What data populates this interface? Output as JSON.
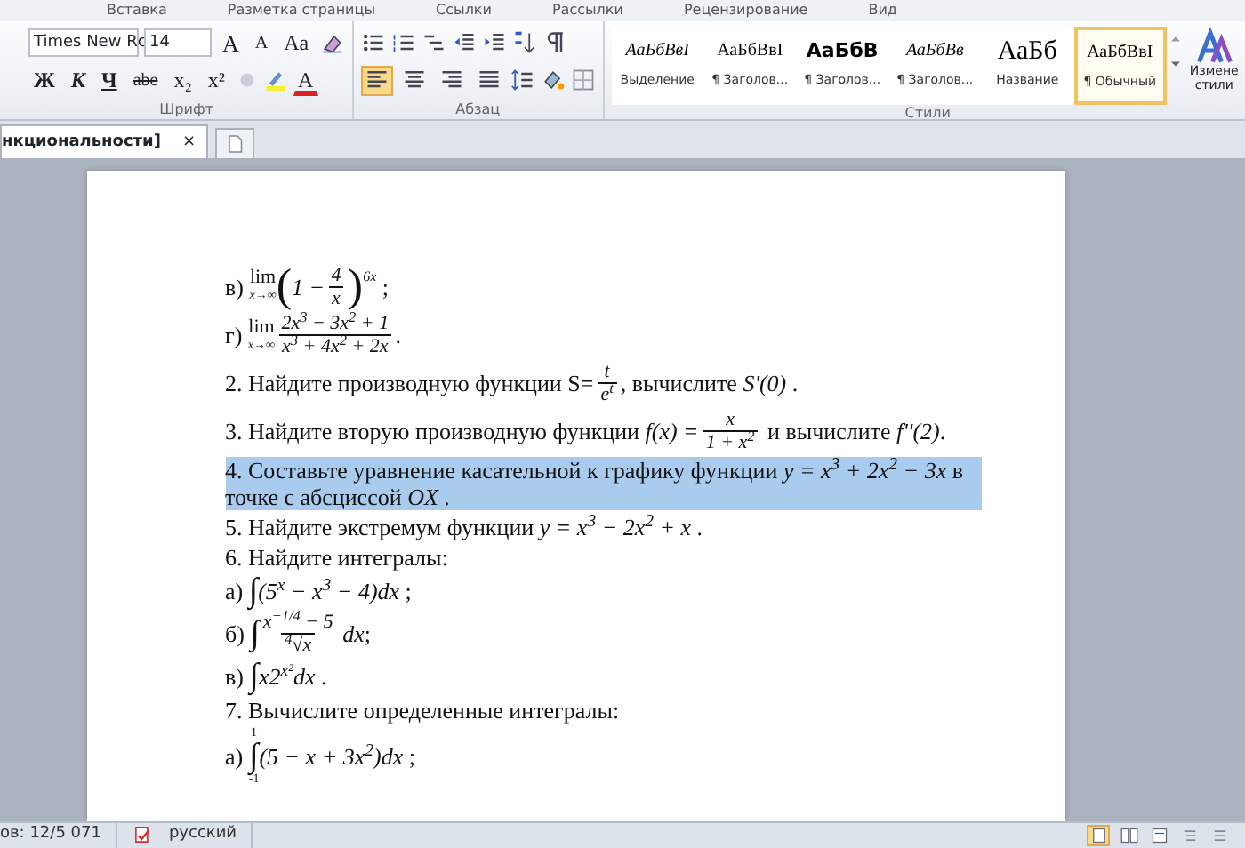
{
  "ribbon_tabs": [
    "Вставка",
    "Разметка страницы",
    "Ссылки",
    "Рассылки",
    "Рецензирование",
    "Вид"
  ],
  "font_group": {
    "font_name": "Times New Rc",
    "font_size": "14",
    "grow_label": "A",
    "shrink_label": "A",
    "case_label": "Aa",
    "color_label": "A",
    "title": "Шрифт",
    "format_buttons": [
      {
        "label": "Ж",
        "kind": "bold"
      },
      {
        "label": "К",
        "kind": "italic"
      },
      {
        "label": "Ч",
        "kind": "underline"
      },
      {
        "label": "abe",
        "kind": "strike"
      },
      {
        "label": "x₂",
        "kind": "plain"
      },
      {
        "label": "x²",
        "kind": "plain"
      }
    ]
  },
  "paragraph_group": {
    "title": "Абзац",
    "alignments": [
      {
        "kind": "left",
        "selected": true
      },
      {
        "kind": "center",
        "selected": false
      },
      {
        "kind": "right",
        "selected": false
      },
      {
        "kind": "justify",
        "selected": false
      }
    ]
  },
  "styles_group": {
    "title": "Стили",
    "change_styles": "Измене стили",
    "styles": [
      {
        "sample": "АаБбВвI",
        "name": "Выделение",
        "kind": "emphasis",
        "selected": false
      },
      {
        "sample": "АаБбВвI",
        "name": "¶ Заголов...",
        "kind": "normal",
        "selected": false
      },
      {
        "sample": "АаБбВ",
        "name": "¶ Заголов...",
        "kind": "heading",
        "selected": false
      },
      {
        "sample": "АаБбВв",
        "name": "¶ Заголов...",
        "kind": "emphasis",
        "selected": false
      },
      {
        "sample": "АаБб",
        "name": "Название",
        "kind": "title",
        "selected": false
      },
      {
        "sample": "АаБбВвI",
        "name": "¶ Обычный",
        "kind": "normal",
        "selected": true
      }
    ]
  },
  "doc_tab": {
    "title": "нкциональности]",
    "close": "×"
  },
  "document": {
    "lines": [
      {
        "highlighted": false,
        "parts": [
          {
            "kind": "text",
            "s": "в) "
          },
          {
            "kind": "lim",
            "s": "lim",
            "sub": "x→∞"
          },
          {
            "kind": "big",
            "s": "("
          },
          {
            "kind": "math",
            "s": "1 −"
          },
          {
            "kind": "frac",
            "num": "4",
            "den": "x"
          },
          {
            "kind": "big",
            "s": ")"
          },
          {
            "kind": "sup",
            "s": "6x"
          },
          {
            "kind": "text",
            "s": " ;"
          }
        ]
      },
      {
        "highlighted": false,
        "parts": [
          {
            "kind": "text",
            "s": "г) "
          },
          {
            "kind": "lim",
            "s": "lim",
            "sub": "x→∞"
          },
          {
            "kind": "frac",
            "num": "2x$^{3}$ − 3x$^{2}$ + 1",
            "den": "x$^{3}$ + 4x$^{2}$ + 2x"
          },
          {
            "kind": "text",
            "s": "."
          }
        ]
      },
      {
        "highlighted": false,
        "parts": [
          {
            "kind": "text",
            "s": "2. Найдите производную функции S="
          },
          {
            "kind": "frac",
            "num": "t",
            "den": "e$^{t}$"
          },
          {
            "kind": "text",
            "s": ", вычислите "
          },
          {
            "kind": "math",
            "s": "S'(0)"
          },
          {
            "kind": "text",
            "s": " ."
          }
        ]
      },
      {
        "highlighted": false,
        "parts": [
          {
            "kind": "text",
            "s": "3. Найдите вторую производную функции "
          },
          {
            "kind": "math",
            "s": "f(x) ="
          },
          {
            "kind": "frac",
            "num": "x",
            "den": "1 + x$^{2}$"
          },
          {
            "kind": "text",
            "s": " и вычислите "
          },
          {
            "kind": "math",
            "s": "f''(2)"
          },
          {
            "kind": "text",
            "s": "."
          }
        ]
      },
      {
        "highlighted": true,
        "parts": [
          {
            "kind": "text",
            "s": "4. Составьте уравнение касательной к графику функции "
          },
          {
            "kind": "math",
            "s": "y = x$^{3}$ + 2x$^{2}$ − 3x"
          },
          {
            "kind": "text",
            "s": " в точке с абсциссой "
          },
          {
            "kind": "math",
            "s": "OX"
          },
          {
            "kind": "text",
            "s": " ."
          }
        ]
      },
      {
        "highlighted": false,
        "parts": [
          {
            "kind": "text",
            "s": "5. Найдите экстремум функции "
          },
          {
            "kind": "math",
            "s": "y = x$^{3}$ − 2x$^{2}$ + x"
          },
          {
            "kind": "text",
            "s": " ."
          }
        ]
      },
      {
        "highlighted": false,
        "parts": [
          {
            "kind": "text",
            "s": "6. Найдите интегралы:"
          }
        ]
      },
      {
        "highlighted": false,
        "parts": [
          {
            "kind": "text",
            "s": "а) "
          },
          {
            "kind": "int",
            "s": "∫"
          },
          {
            "kind": "math",
            "s": "(5$^{x}$ − x$^{3}$ − 4)dx"
          },
          {
            "kind": "text",
            "s": " ;"
          }
        ]
      },
      {
        "highlighted": false,
        "parts": [
          {
            "kind": "text",
            "s": "б) "
          },
          {
            "kind": "int",
            "s": "∫"
          },
          {
            "kind": "frac",
            "num": "x$^{−1/4}$ − 5",
            "den": "$^{4}$√x"
          },
          {
            "kind": "math",
            "s": " dx"
          },
          {
            "kind": "text",
            "s": ";"
          }
        ]
      },
      {
        "highlighted": false,
        "parts": [
          {
            "kind": "text",
            "s": "в) "
          },
          {
            "kind": "int",
            "s": "∫"
          },
          {
            "kind": "math",
            "s": "x2$^{x²}$dx"
          },
          {
            "kind": "text",
            "s": " ."
          }
        ]
      },
      {
        "highlighted": false,
        "parts": [
          {
            "kind": "text",
            "s": "7. Вычислите определенные интегралы:"
          }
        ]
      },
      {
        "highlighted": false,
        "parts": [
          {
            "kind": "text",
            "s": "а) "
          },
          {
            "kind": "int",
            "s": "∫",
            "upper": "1",
            "lower": "-1"
          },
          {
            "kind": "math",
            "s": "(5 − x + 3x$^{2}$)dx"
          },
          {
            "kind": "text",
            "s": " ;"
          }
        ]
      }
    ]
  },
  "status_bar": {
    "words": "ов: 12/5 071",
    "language": "русский",
    "views": [
      {
        "selected": true
      },
      {
        "selected": false
      },
      {
        "selected": false
      },
      {
        "selected": false
      },
      {
        "selected": false
      }
    ]
  }
}
